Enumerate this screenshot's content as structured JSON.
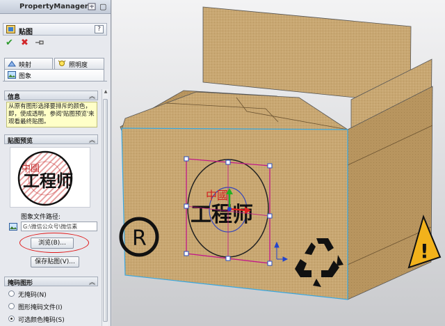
{
  "property_manager": {
    "title": "PropertyManager",
    "feature_title": "贴图",
    "help_label": "?",
    "tabs": [
      {
        "label": "映射"
      },
      {
        "label": "照明度"
      },
      {
        "label": "图象"
      }
    ],
    "info": {
      "header": "信息",
      "text": "从原有图形选择要排斥的颜色，即，使成透明。参阅'贴图预览'来观看最终贴图。"
    },
    "preview": {
      "header": "贴图预览",
      "file_path_label": "图象文件路径:",
      "file_path_value": "G:\\微信公众号\\微信素",
      "browse_label": "浏览(B)...",
      "save_label": "保存贴图(V)..."
    },
    "mask": {
      "header": "掩码图形",
      "options": [
        {
          "label": "无掩码(N)",
          "selected": false
        },
        {
          "label": "图形掩码文件(I)",
          "selected": false
        },
        {
          "label": "可选颜色掩码(S)",
          "selected": true
        }
      ]
    }
  },
  "decal": {
    "stamp_top": "中國",
    "stamp_main": "工程师"
  },
  "box_symbols": {
    "registered": "R",
    "warning": "!"
  },
  "colors": {
    "cardboard": "#c8a772",
    "selection": "#c2188a",
    "annotation_ring": "#e01818"
  }
}
